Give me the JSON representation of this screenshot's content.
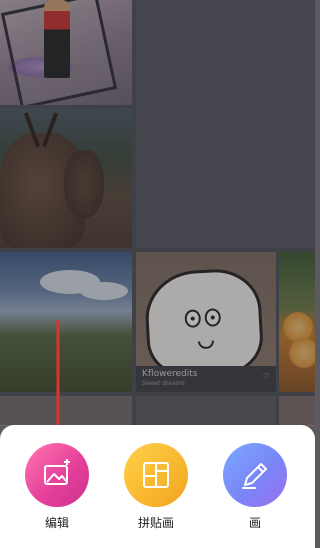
{
  "gallery": {
    "caption_title": "Kfloweredits",
    "caption_sub": "Sweet dreams",
    "caption_icon": "heart-icon"
  },
  "actions": [
    {
      "label": "编辑",
      "icon": "image-edit-icon",
      "color": "#e6409a"
    },
    {
      "label": "拼贴画",
      "icon": "collage-grid-icon",
      "color": "#f8b62e"
    },
    {
      "label": "画",
      "icon": "pencil-icon",
      "color": "#7a86f6"
    }
  ],
  "annotation": {
    "arrow_color": "#d9352f"
  }
}
